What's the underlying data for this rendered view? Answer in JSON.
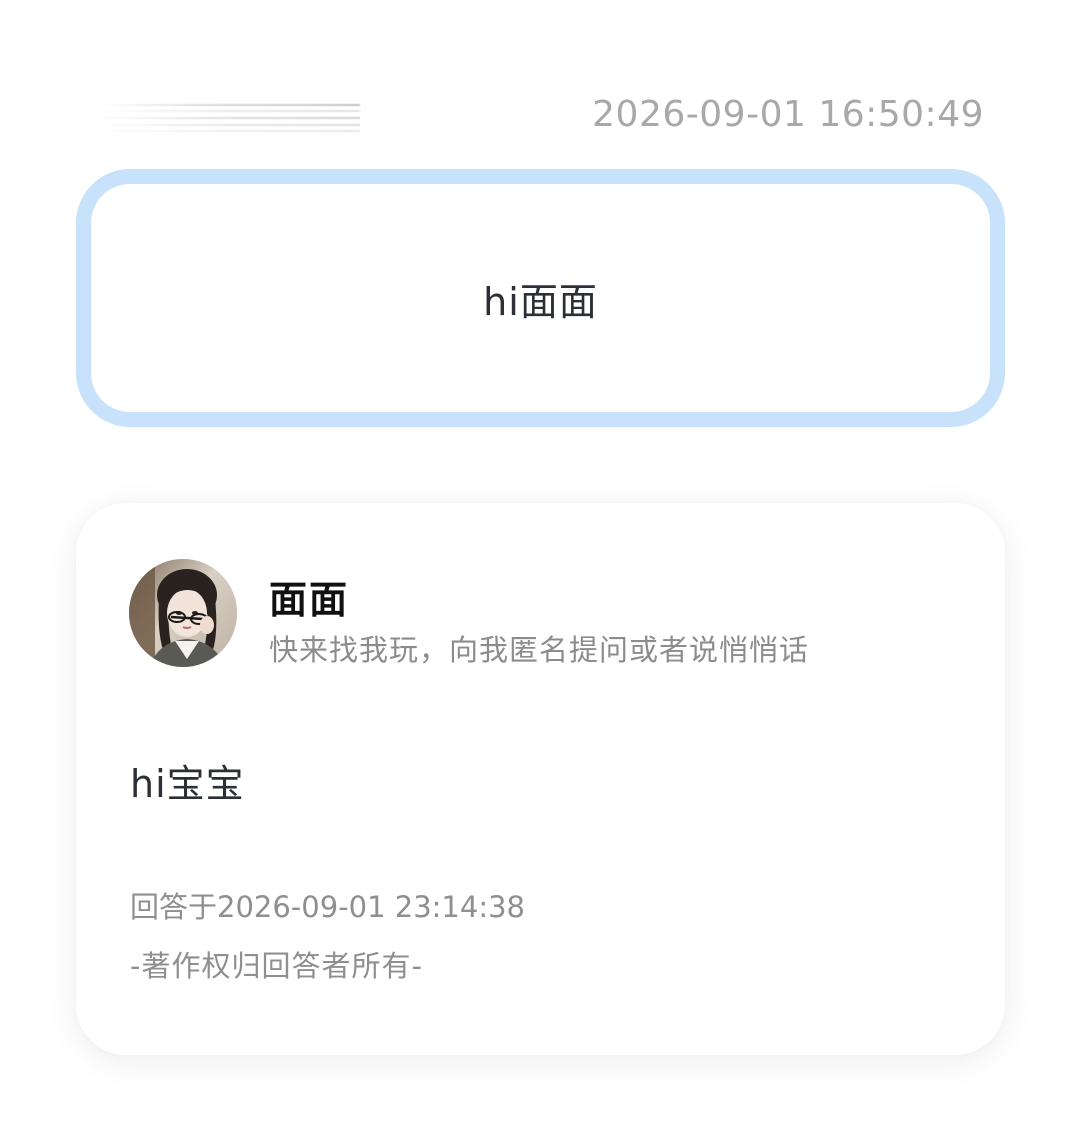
{
  "header": {
    "timestamp": "2026-09-01 16:50:49"
  },
  "question": {
    "text": "hi面面"
  },
  "answer": {
    "answerer_name": "面面",
    "answerer_bio": "快来找我玩，向我匿名提问或者说悄悄话",
    "text": "hi宝宝",
    "answered_at": "回答于2026-09-01 23:14:38",
    "copyright": "-著作权归回答者所有-"
  },
  "colors": {
    "question_border": "#c7e2fa",
    "timestamp": "#a8a8a8",
    "muted_text": "#8f8f8f",
    "primary_text": "#2c2f36"
  }
}
